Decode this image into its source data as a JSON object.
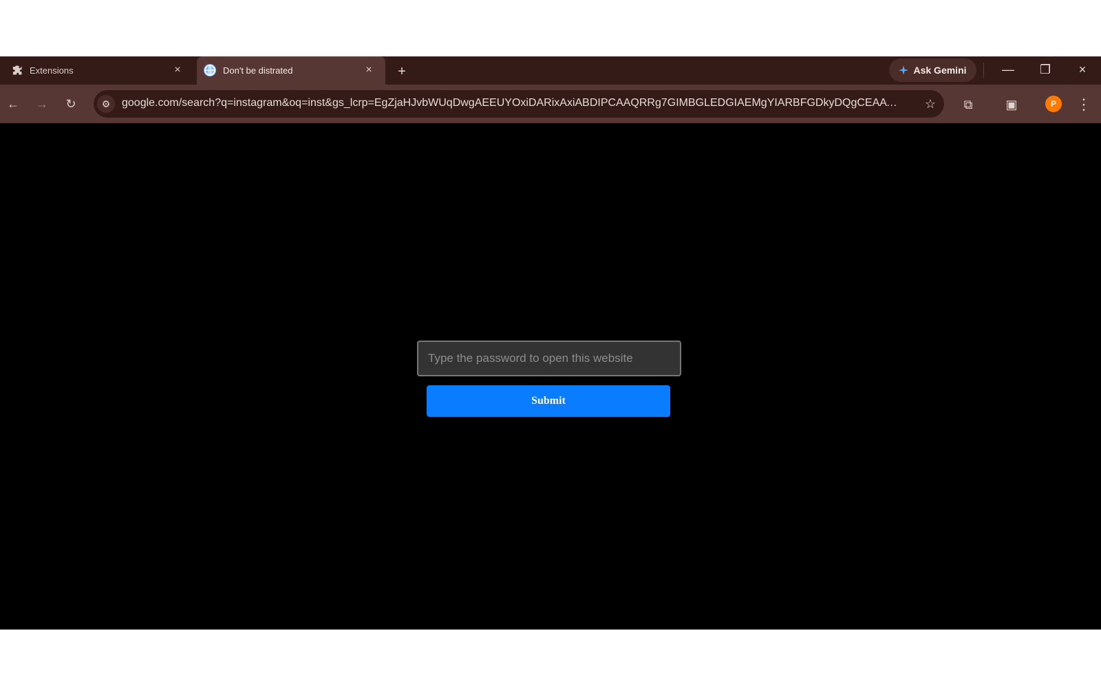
{
  "browser": {
    "tabs": [
      {
        "title": "Extensions",
        "icon": "puzzle-icon",
        "close_label": "×",
        "active": false
      },
      {
        "title": "Don't be distrated",
        "icon": "globe-icon",
        "close_label": "×",
        "active": true
      }
    ],
    "new_tab_label": "+",
    "gemini": {
      "label": "Ask Gemini",
      "icon": "sparkle-icon"
    },
    "window_controls": {
      "minimize": "—",
      "restore": "❐",
      "close": "×"
    },
    "toolbar": {
      "back_icon": "←",
      "forward_icon": "→",
      "reload_icon": "↻",
      "site_settings_icon": "⚙",
      "url": "google.com/search?q=instagram&oq=inst&gs_lcrp=EgZjaHJvbWUqDwgAEEUYOxiDARixAxiABDIPCAAQRRg7GIMBGLEDGIAEMgYIARBFGDkyDQgCEAAYgw...",
      "bookmark_icon": "☆",
      "extensions_icon": "⧉",
      "side_panel_icon": "▣",
      "profile_initial": "P",
      "menu_icon": "⋮"
    }
  },
  "page": {
    "password": {
      "value": "",
      "placeholder": "Type the password to open this website"
    },
    "submit_label": "Submit"
  },
  "colors": {
    "tab_strip": "#351b18",
    "toolbar": "#573734",
    "content": "#000000",
    "input_background": "#333333",
    "submit_button": "#0a7cff",
    "profile_accent": "#ff7a00"
  }
}
